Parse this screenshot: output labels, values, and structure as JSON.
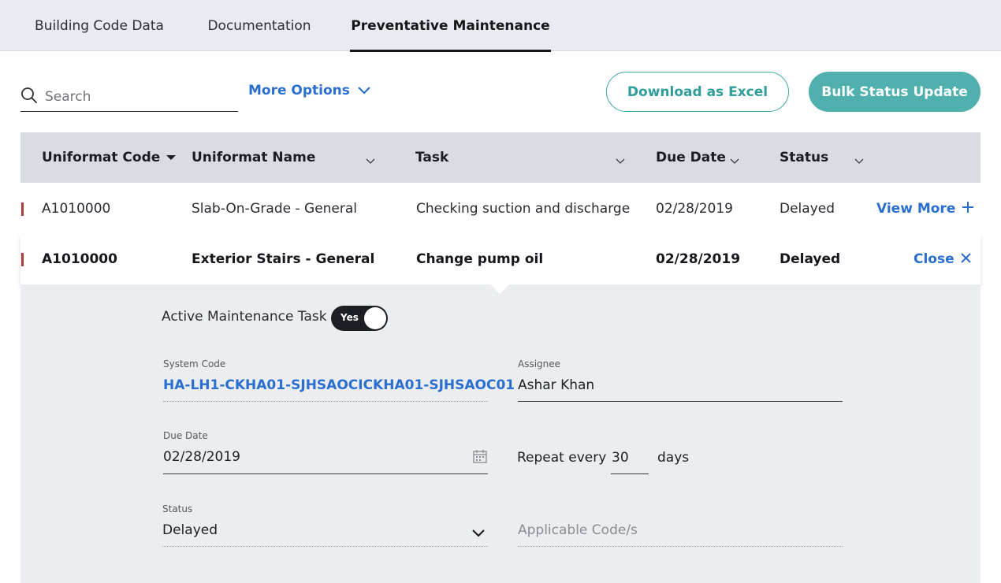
{
  "tabs": [
    {
      "label": "Building Code Data"
    },
    {
      "label": "Documentation"
    },
    {
      "label": "Preventative Maintenance"
    }
  ],
  "toolbar": {
    "search_placeholder": "Search",
    "more_options": "More Options",
    "download_excel": "Download as Excel",
    "bulk_update": "Bulk Status Update"
  },
  "table": {
    "columns": [
      "Uniformat Code",
      "Uniformat Name",
      "Task",
      "Due Date",
      "Status"
    ],
    "rows": [
      {
        "code": "A1010000",
        "name": "Slab-On-Grade - General",
        "task": "Checking suction and discharge",
        "due": "02/28/2019",
        "status": "Delayed",
        "action": "View More"
      },
      {
        "code": "A1010000",
        "name": "Exterior Stairs - General",
        "task": "Change pump oil",
        "due": "02/28/2019",
        "status": "Delayed",
        "action": "Close"
      }
    ]
  },
  "detail": {
    "active_label": "Active Maintenance Task",
    "toggle_text": "Yes",
    "system_code_label": "System Code",
    "system_code": "HA-LH1-CKHA01-SJHSAOCICKHA01-SJHSAOC01",
    "assignee_label": "Assignee",
    "assignee": "Ashar Khan",
    "due_date_label": "Due Date",
    "due_date": "02/28/2019",
    "repeat_label": "Repeat every",
    "repeat_value": "30",
    "repeat_unit": "days",
    "status_label": "Status",
    "status_value": "Delayed",
    "codes_placeholder": "Applicable Code/s"
  },
  "colors": {
    "accent_teal": "#4fb0ad",
    "link_blue": "#2a6fcf",
    "marker_red": "#b03a3a"
  }
}
